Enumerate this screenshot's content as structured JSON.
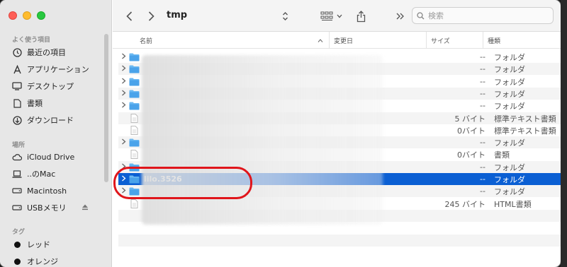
{
  "toolbar": {
    "title": "tmp",
    "search_placeholder": "検索"
  },
  "sidebar": {
    "favorites_heading": "よく使う項目",
    "favorites": [
      {
        "label": "最近の項目",
        "icon": "clock-icon"
      },
      {
        "label": "アプリケーション",
        "icon": "applications-icon"
      },
      {
        "label": "デスクトップ",
        "icon": "desktop-icon"
      },
      {
        "label": "書類",
        "icon": "document-icon"
      },
      {
        "label": "ダウンロード",
        "icon": "download-icon"
      }
    ],
    "locations_heading": "場所",
    "locations": [
      {
        "label": "iCloud Drive",
        "icon": "cloud-icon"
      },
      {
        "label": "..のMac",
        "icon": "laptop-icon"
      },
      {
        "label": "Macintosh",
        "icon": "disk-icon"
      },
      {
        "label": "USBメモリ",
        "icon": "usb-disk-icon"
      }
    ],
    "tags_heading": "タグ",
    "tags": [
      {
        "label": "レッド"
      },
      {
        "label": "オレンジ"
      }
    ]
  },
  "columns": {
    "name": "名前",
    "modified": "変更日",
    "size": "サイズ",
    "kind": "種類"
  },
  "rows": [
    {
      "name": "",
      "size": "--",
      "kind": "フォルダ",
      "type": "folder",
      "expand": true
    },
    {
      "name": "",
      "size": "--",
      "kind": "フォルダ",
      "type": "folder",
      "expand": true
    },
    {
      "name": "",
      "size": "--",
      "kind": "フォルダ",
      "type": "folder",
      "expand": true
    },
    {
      "name": "",
      "size": "--",
      "kind": "フォルダ",
      "type": "folder",
      "expand": true
    },
    {
      "name": "",
      "size": "--",
      "kind": "フォルダ",
      "type": "folder",
      "expand": true
    },
    {
      "name": "",
      "size": "5 バイト",
      "kind": "標準テキスト書類",
      "type": "file",
      "expand": false
    },
    {
      "name": "",
      "size": "0バイト",
      "kind": "標準テキスト書類",
      "type": "file",
      "expand": false
    },
    {
      "name": "",
      "size": "--",
      "kind": "フォルダ",
      "type": "folder",
      "expand": true
    },
    {
      "name": "",
      "size": "0バイト",
      "kind": "書類",
      "type": "file",
      "expand": false
    },
    {
      "name": "",
      "size": "--",
      "kind": "フォルダ",
      "type": "folder",
      "expand": true
    },
    {
      "name": "lilo.3526",
      "size": "--",
      "kind": "フォルダ",
      "type": "folder",
      "expand": true,
      "selected": true
    },
    {
      "name": "",
      "size": "--",
      "kind": "フォルダ",
      "type": "folder",
      "expand": true
    },
    {
      "name": "",
      "size": "245 バイト",
      "kind": "HTML書類",
      "type": "file",
      "expand": false
    }
  ]
}
